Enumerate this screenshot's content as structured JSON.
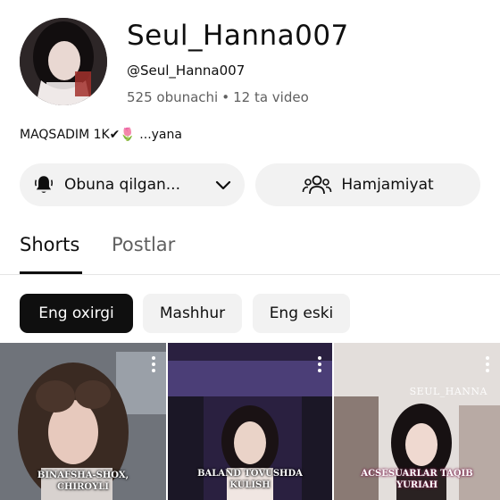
{
  "channel": {
    "name": "Seul_Hanna007",
    "handle": "@Seul_Hanna007",
    "subscribers": "525 obunachi",
    "separator": "•",
    "videos": "12 ta video",
    "bio": "MAQSADIM 1K✔🌷 ...yana"
  },
  "actions": {
    "subscribed_label": "Obuna qilgan...",
    "community_label": "Hamjamiyat"
  },
  "tabs": [
    {
      "label": "Shorts",
      "active": true
    },
    {
      "label": "Postlar",
      "active": false
    }
  ],
  "filters": [
    {
      "label": "Eng oxirgi",
      "selected": true
    },
    {
      "label": "Mashhur",
      "selected": false
    },
    {
      "label": "Eng eski",
      "selected": false
    }
  ],
  "shorts": [
    {
      "caption_line1": "BINAFSHA-SHOX,",
      "caption_line2": "CHIROYLI"
    },
    {
      "caption_line1": "BALAND TOVUSHDA",
      "caption_line2": "KULISH"
    },
    {
      "caption_line1": "ACSESUARLAR TAQIB",
      "caption_line2": "YURIAH",
      "watermark": "SEUL_HANNA"
    }
  ],
  "colors": {
    "text_primary": "#0f0f0f",
    "text_secondary": "#606060",
    "chip_selected_bg": "#0f0f0f",
    "chip_bg": "#f2f2f2"
  }
}
